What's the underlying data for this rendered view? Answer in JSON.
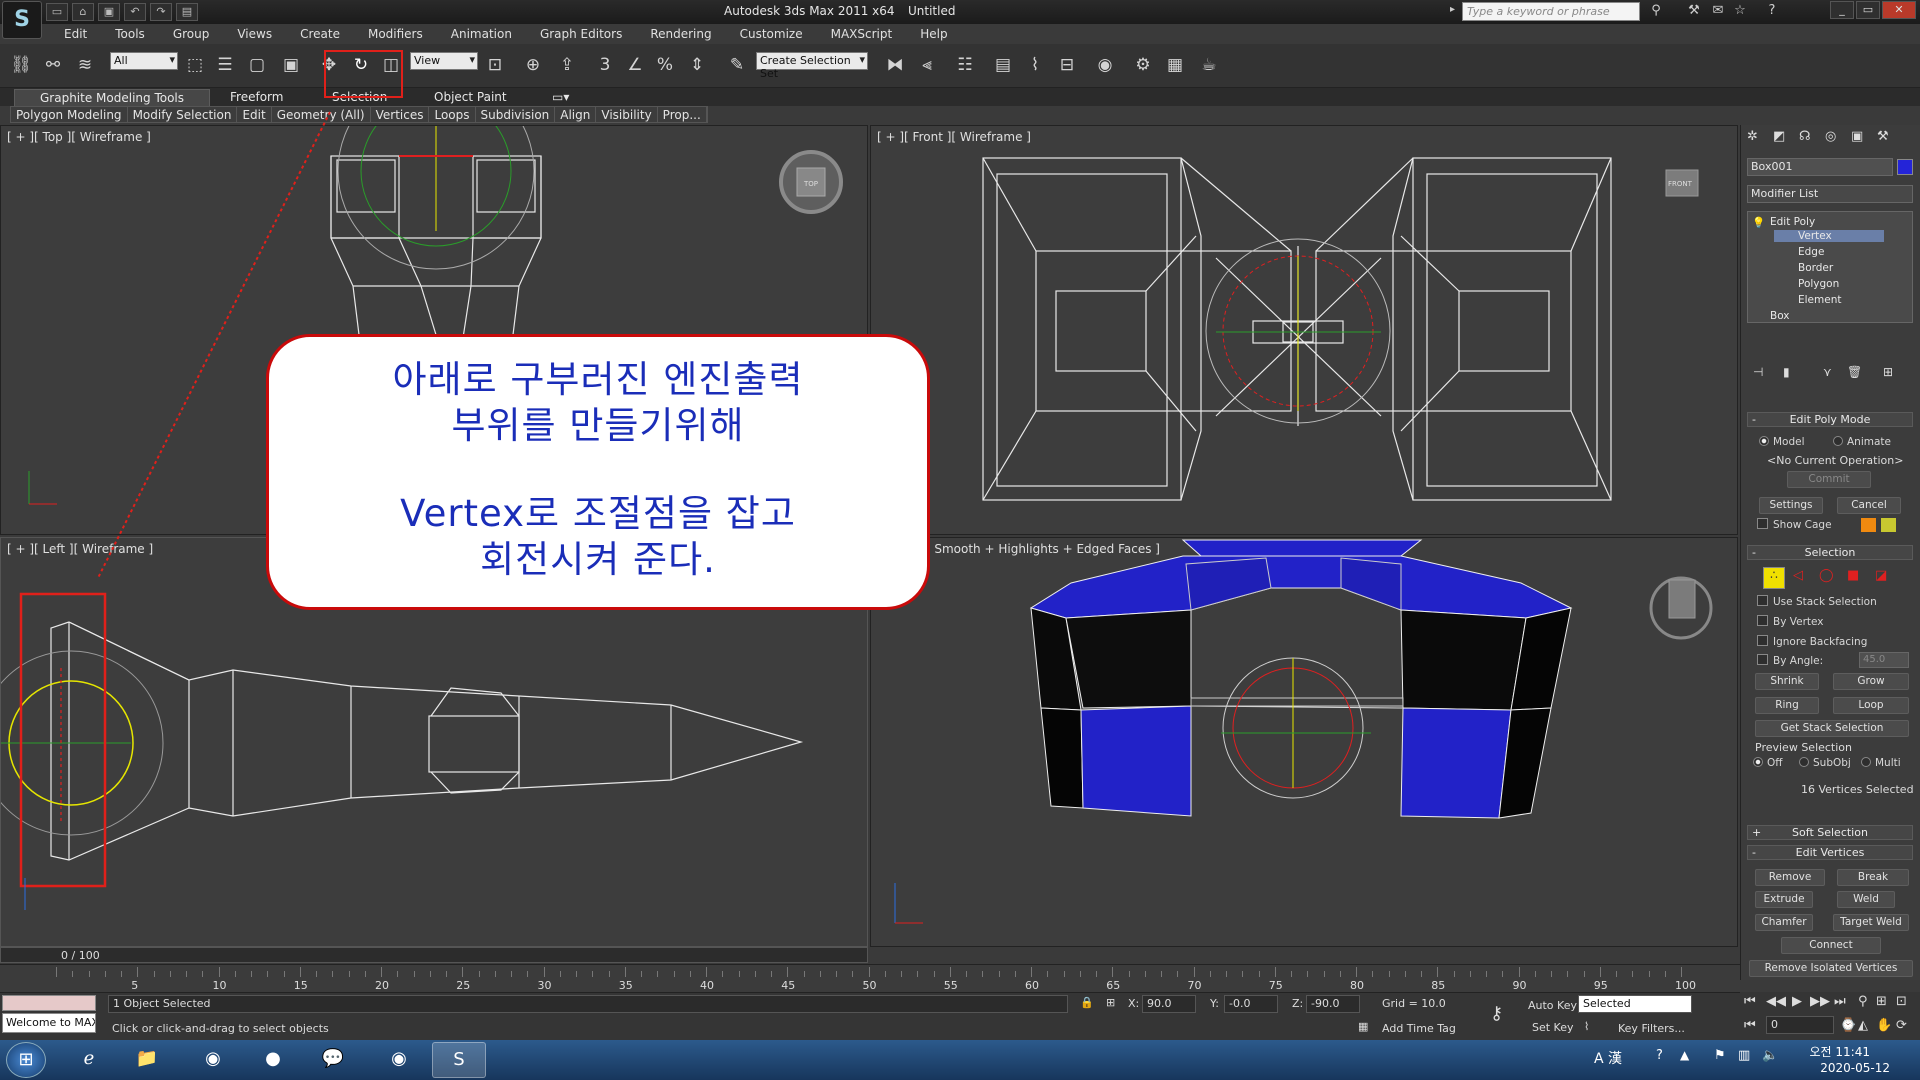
{
  "titlebar": {
    "app_title": "Autodesk 3ds Max  2011 x64",
    "doc_title": "Untitled",
    "search_placeholder": "Type a keyword or phrase"
  },
  "menu": [
    "Edit",
    "Tools",
    "Group",
    "Views",
    "Create",
    "Modifiers",
    "Animation",
    "Graph Editors",
    "Rendering",
    "Customize",
    "MAXScript",
    "Help"
  ],
  "toolbar": {
    "selection_filter": "All",
    "ref_coord": "View",
    "named_selection": "Create Selection Set"
  },
  "ribbon": {
    "tabs": [
      "Graphite Modeling Tools",
      "Freeform",
      "Selection",
      "Object Paint"
    ],
    "sub": [
      "Polygon Modeling",
      "Modify Selection",
      "Edit",
      "Geometry (All)",
      "Vertices",
      "Loops",
      "Subdivision",
      "Align",
      "Visibility",
      "Prop..."
    ]
  },
  "viewports": {
    "top": "[ + ][ Top ][ Wireframe ]",
    "front": "[ + ][ Front ][ Wireframe ]",
    "left": "[ + ][ Left ][ Wireframe ]",
    "persp": "spective ][ Smooth + Highlights + Edged Faces ]",
    "cube_top": "TOP",
    "cube_front": "FRONT"
  },
  "callout": {
    "line1": "아래로 구부러진 엔진출력",
    "line2": "부위를 만들기위해",
    "line3": "Vertex로 조절점을 잡고",
    "line4": "회전시켜 준다."
  },
  "command_panel": {
    "object_name": "Box001",
    "modifier_list": "Modifier List",
    "stack": [
      "Edit Poly",
      "Vertex",
      "Edge",
      "Border",
      "Polygon",
      "Element",
      "Box"
    ],
    "edit_poly_mode": {
      "title": "Edit Poly Mode",
      "model": "Model",
      "animate": "Animate",
      "current_op": "<No Current Operation>",
      "commit": "Commit",
      "settings": "Settings",
      "cancel": "Cancel",
      "show_cage": "Show Cage"
    },
    "selection": {
      "title": "Selection",
      "use_stack": "Use Stack Selection",
      "by_vertex": "By Vertex",
      "ignore_backfacing": "Ignore Backfacing",
      "by_angle": "By Angle:",
      "angle_value": "45.0",
      "shrink": "Shrink",
      "grow": "Grow",
      "ring": "Ring",
      "loop": "Loop",
      "get_stack": "Get Stack Selection",
      "preview": "Preview Selection",
      "off": "Off",
      "subobj": "SubObj",
      "multi": "Multi",
      "count": "16 Vertices Selected"
    },
    "soft_selection": "Soft Selection",
    "edit_vertices": {
      "title": "Edit Vertices",
      "remove": "Remove",
      "break": "Break",
      "extrude": "Extrude",
      "weld": "Weld",
      "chamfer": "Chamfer",
      "target_weld": "Target Weld",
      "connect": "Connect",
      "remove_isolated": "Remove Isolated Vertices"
    }
  },
  "timeline": {
    "frame": "0 / 100",
    "ticks": [
      "5",
      "10",
      "15",
      "20",
      "25",
      "30",
      "35",
      "40",
      "45",
      "50",
      "55",
      "60",
      "65",
      "70",
      "75",
      "80",
      "85",
      "90",
      "95",
      "100"
    ]
  },
  "status": {
    "welcome": "Welcome to MAXScript",
    "selected": "1 Object Selected",
    "prompt": "Click or click-and-drag to select objects",
    "x_label": "X:",
    "x": "90.0",
    "y_label": "Y:",
    "y": "-0.0",
    "z_label": "Z:",
    "z": "-90.0",
    "grid": "Grid = 10.0",
    "auto_key": "Auto Key",
    "set_key": "Set Key",
    "key_mode": "Selected",
    "key_filters": "Key Filters...",
    "add_time_tag": "Add Time Tag",
    "current_frame": "0"
  },
  "taskbar": {
    "time": "오전 11:41",
    "date": "2020-05-12",
    "ime": "A 漢"
  },
  "colors": {
    "highlight": "#e0201a",
    "callout_text": "#1a2db8",
    "mesh_blue": "#2222c8"
  }
}
